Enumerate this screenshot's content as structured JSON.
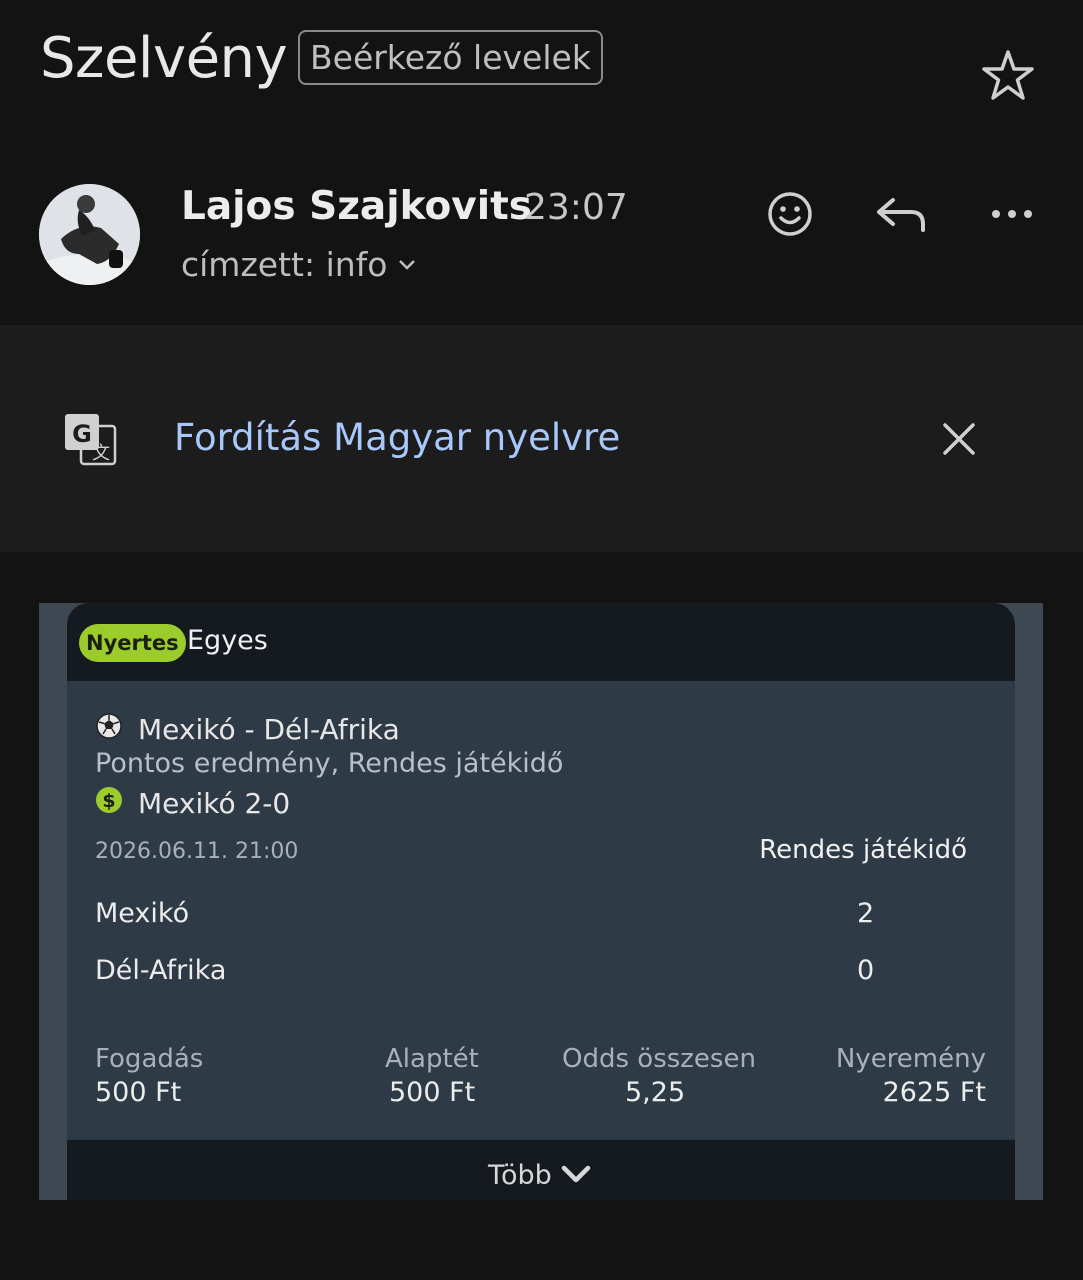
{
  "header": {
    "subject": "Szelvény",
    "label": "Beérkező levelek",
    "star_icon": "star-outline-icon"
  },
  "message": {
    "sender_name": "Lajos Szajkovits",
    "time": "23:07",
    "recipient": "címzett: info",
    "actions": [
      "emoji-icon",
      "reply-icon",
      "more-vert-icon"
    ]
  },
  "translate": {
    "link_text": "Fordítás Magyar nyelvre",
    "icon": "google-translate-icon",
    "close_icon": "close-icon"
  },
  "bet": {
    "status_badge": "Nyertes",
    "bet_type": "Egyes",
    "match": "Mexikó - Dél-Afrika",
    "market": "Pontos eredmény, Rendes játékidő",
    "selection": "Mexikó 2-0",
    "datetime": "2026.06.11.  21:00",
    "period_header": "Rendes játékidő",
    "teams": [
      {
        "name": "Mexikó",
        "score": "2"
      },
      {
        "name": "Dél-Afrika",
        "score": "0"
      }
    ],
    "stats": {
      "stake_label": "Fogadás",
      "stake_value": "500 Ft",
      "base_label": "Alaptét",
      "base_value": "500 Ft",
      "odds_label": "Odds összesen",
      "odds_value": "5,25",
      "win_label": "Nyeremény",
      "win_value": "2625 Ft"
    },
    "more_label": "Több",
    "colors": {
      "badge": "#9ccc2c",
      "card": "#2e3a46",
      "card_header": "#141a20"
    }
  }
}
